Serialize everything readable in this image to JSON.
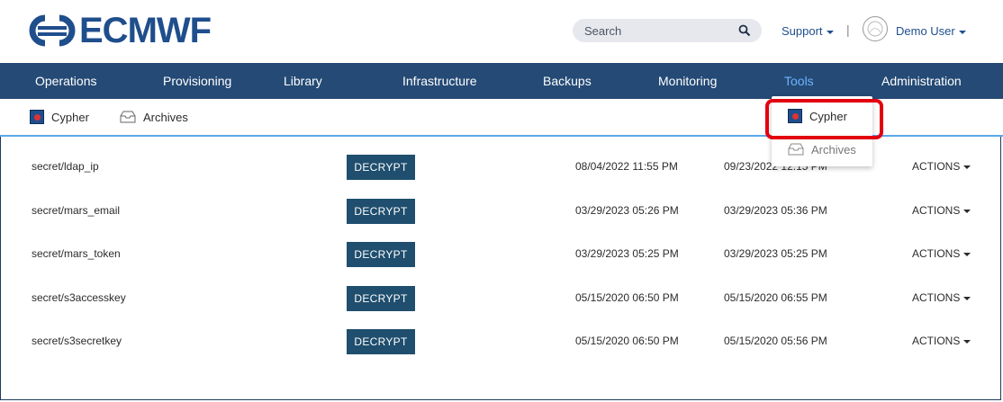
{
  "header": {
    "logo_text": "ECMWF",
    "search_placeholder": "Search",
    "support_label": "Support",
    "separator": "|",
    "user_label": "Demo User"
  },
  "nav": {
    "items": [
      {
        "label": "Operations"
      },
      {
        "label": "Provisioning"
      },
      {
        "label": "Library"
      },
      {
        "label": "Infrastructure"
      },
      {
        "label": "Backups"
      },
      {
        "label": "Monitoring"
      },
      {
        "label": "Tools",
        "active": true
      },
      {
        "label": "Administration"
      }
    ]
  },
  "subnav": {
    "items": [
      {
        "label": "Cypher",
        "icon": "cypher-icon"
      },
      {
        "label": "Archives",
        "icon": "archive-icon"
      }
    ]
  },
  "dropdown": {
    "items": [
      {
        "label": "Cypher",
        "icon": "cypher-icon"
      },
      {
        "label": "Archives",
        "icon": "archive-icon"
      }
    ]
  },
  "table": {
    "decrypt_label": "DECRYPT",
    "actions_label": "ACTIONS",
    "rows": [
      {
        "key": "secret/ldap_ip",
        "created": "08/04/2022 11:55 PM",
        "updated": "09/23/2022 12:15 PM"
      },
      {
        "key": "secret/mars_email",
        "created": "03/29/2023 05:26 PM",
        "updated": "03/29/2023 05:36 PM"
      },
      {
        "key": "secret/mars_token",
        "created": "03/29/2023 05:25 PM",
        "updated": "03/29/2023 05:25 PM"
      },
      {
        "key": "secret/s3accesskey",
        "created": "05/15/2020 06:50 PM",
        "updated": "05/15/2020 06:55 PM"
      },
      {
        "key": "secret/s3secretkey",
        "created": "05/15/2020 06:50 PM",
        "updated": "05/15/2020 05:56 PM"
      }
    ]
  },
  "colors": {
    "nav_bg": "#244a75",
    "nav_active": "#6fb4ff",
    "button_bg": "#1f4e6e",
    "logo": "#1f4e8c",
    "highlight": "#e3000f"
  }
}
